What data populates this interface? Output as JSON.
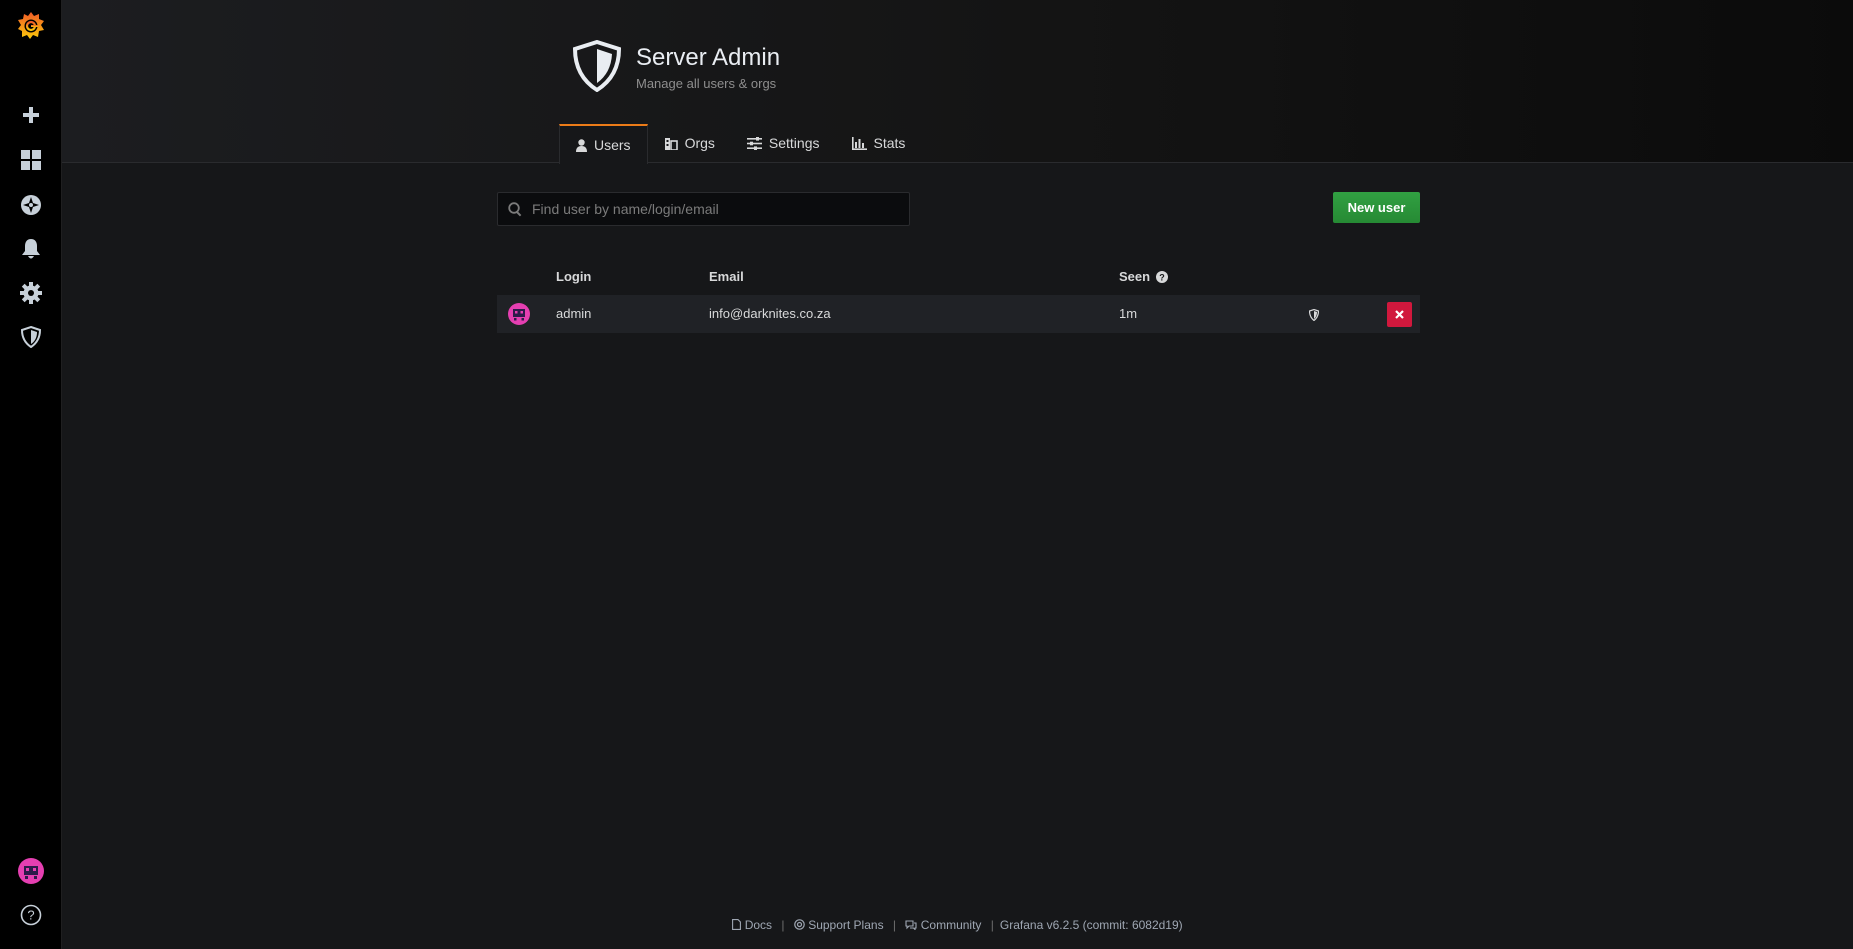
{
  "sidebar": {
    "items": [
      {
        "name": "grafana-logo",
        "icon": "grafana-logo-icon"
      },
      {
        "name": "create",
        "icon": "plus-icon"
      },
      {
        "name": "dashboards",
        "icon": "apps-icon"
      },
      {
        "name": "explore",
        "icon": "compass-icon"
      },
      {
        "name": "alerting",
        "icon": "bell-icon"
      },
      {
        "name": "configuration",
        "icon": "gear-icon"
      },
      {
        "name": "server-admin",
        "icon": "shield-icon"
      }
    ],
    "bottom": [
      {
        "name": "profile",
        "icon": "avatar-icon"
      },
      {
        "name": "help",
        "icon": "question-circle-icon"
      }
    ]
  },
  "header": {
    "title": "Server Admin",
    "subtitle": "Manage all users & orgs",
    "tabs": [
      {
        "label": "Users",
        "icon": "user-icon",
        "active": true
      },
      {
        "label": "Orgs",
        "icon": "building-icon",
        "active": false
      },
      {
        "label": "Settings",
        "icon": "sliders-icon",
        "active": false
      },
      {
        "label": "Stats",
        "icon": "bar-chart-icon",
        "active": false
      }
    ]
  },
  "toolbar": {
    "search_placeholder": "Find user by name/login/email",
    "search_value": "",
    "new_user_label": "New user"
  },
  "table": {
    "columns": {
      "login": "Login",
      "email": "Email",
      "seen": "Seen"
    },
    "rows": [
      {
        "login": "admin",
        "email": "info@darknites.co.za",
        "seen": "1m",
        "is_admin": true
      }
    ]
  },
  "footer": {
    "docs": "Docs",
    "support": "Support Plans",
    "community": "Community",
    "version": "Grafana v6.2.5 (commit: 6082d19)"
  },
  "colors": {
    "accent_orange": "#eb7b18",
    "success_green": "#299c46",
    "danger_red": "#d1183d",
    "avatar_pink": "#e53fb1"
  }
}
